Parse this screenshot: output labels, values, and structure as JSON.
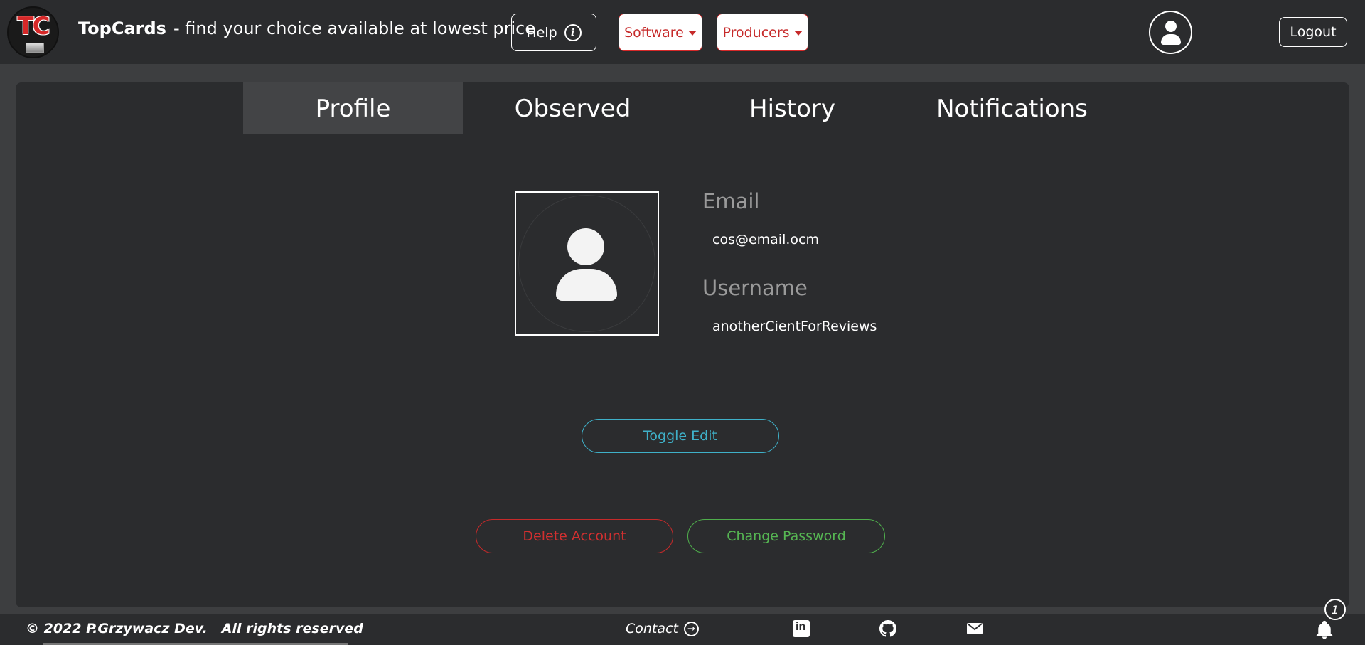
{
  "navbar": {
    "logo_text": "TC",
    "brand_name": "TopCards",
    "tagline": "- find your choice available at lowest price",
    "help_label": "Help",
    "software_label": "Software",
    "producers_label": "Producers",
    "logout_label": "Logout"
  },
  "tabs": [
    "Profile",
    "Observed",
    "History",
    "Notifications"
  ],
  "active_tab": "Profile",
  "profile": {
    "email_label": "Email",
    "email_value": "cos@email.ocm",
    "username_label": "Username",
    "username_value": "anotherCientForReviews"
  },
  "buttons": {
    "toggle_edit": "Toggle Edit",
    "delete_account": "Delete Account",
    "change_password": "Change Password"
  },
  "footer": {
    "copyright": "© 2022 P.Grzywacz Dev.",
    "rights": "All rights reserved",
    "contact": "Contact",
    "notification_count": "1"
  },
  "colors": {
    "brand_red": "#c62a2a",
    "toggle_blue": "#3fb1c9",
    "success_green": "#56b653",
    "panel_bg": "#2b2c2e"
  },
  "icons": [
    "info-icon",
    "caret-down-icon",
    "user-avatar-icon",
    "arrow-right-icon",
    "linkedin-icon",
    "github-icon",
    "mail-icon",
    "bell-icon"
  ]
}
